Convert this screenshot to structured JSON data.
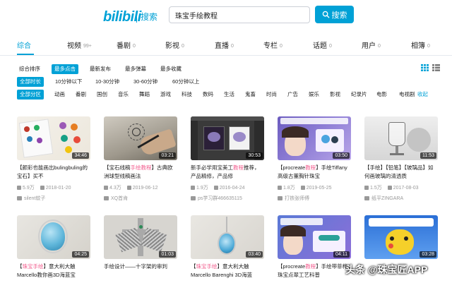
{
  "header": {
    "logo": "bilibili",
    "logo_sub": "搜索",
    "search_value": "珠宝手绘教程",
    "search_button": "搜索"
  },
  "type_tabs": [
    {
      "label": "综合",
      "count": ""
    },
    {
      "label": "视频",
      "count": "99+"
    },
    {
      "label": "番剧",
      "count": "0"
    },
    {
      "label": "影视",
      "count": "0"
    },
    {
      "label": "直播",
      "count": "0"
    },
    {
      "label": "专栏",
      "count": "0"
    },
    {
      "label": "话题",
      "count": "0"
    },
    {
      "label": "用户",
      "count": "0"
    },
    {
      "label": "相簿",
      "count": "0"
    }
  ],
  "sort_row": [
    "综合排序",
    "最多点击",
    "最新发布",
    "最多弹幕",
    "最多收藏"
  ],
  "duration_row": [
    "全部时长",
    "10分钟以下",
    "10-30分钟",
    "30-60分钟",
    "60分钟以上"
  ],
  "zone_row": [
    "全部分区",
    "动画",
    "番剧",
    "国创",
    "音乐",
    "舞蹈",
    "游戏",
    "科技",
    "数码",
    "生活",
    "鬼畜",
    "时尚",
    "广告",
    "娱乐",
    "影视",
    "纪录片",
    "电影",
    "电视剧"
  ],
  "zone_more": "收起",
  "cards": [
    {
      "duration": "34:46",
      "title_pre": "【颜彩也能画出bulingbuling的宝石】买不",
      "title_hl": "",
      "title_post": "",
      "views": "5.9万",
      "date": "2018-01-20",
      "uploader": "silent蚊子"
    },
    {
      "duration": "03:21",
      "title_pre": "【宝石线稿",
      "title_hl": "手绘教程",
      "title_post": "】古典欧洲球型线稿画法",
      "views": "4.3万",
      "date": "2019-06-12",
      "uploader": "XQ首肯"
    },
    {
      "duration": "30:53",
      "title_pre": "新手必学用宝美工",
      "title_hl": "教程",
      "title_post": "推荐，产品精修，产品修",
      "views": "1.9万",
      "date": "2016-04-24",
      "uploader": "ps学习群466635115"
    },
    {
      "duration": "03:50",
      "title_pre": "【procreate",
      "title_hl": "教程",
      "title_post": "】手绘Tiffany高级古董胸针珠宝",
      "views": "1.8万",
      "date": "2019-05-25",
      "uploader": "打铁张师傅"
    },
    {
      "duration": "11:53",
      "title_pre": "【手绘】【铅笔】【玻璃品】如何画玻璃的清透质",
      "title_hl": "",
      "title_post": "",
      "views": "1.5万",
      "date": "2017-08-03",
      "uploader": "纸平ZINGARA"
    },
    {
      "duration": "04:25",
      "title_pre": "【",
      "title_hl": "珠宝手绘",
      "title_post": "】意大利大触Marcello教你画3D海蓝宝",
      "views": "",
      "date": "",
      "uploader": ""
    },
    {
      "duration": "01:03",
      "title_pre": "手绘设计——十字架的审判",
      "title_hl": "",
      "title_post": "",
      "views": "",
      "date": "",
      "uploader": ""
    },
    {
      "duration": "03:40",
      "title_pre": "【",
      "title_hl": "珠宝手绘",
      "title_post": "】意大利大触Marcello Barenghi 3D海蓝",
      "views": "",
      "date": "",
      "uploader": ""
    },
    {
      "duration": "04:11",
      "title_pre": "【procreate",
      "title_hl": "教程",
      "title_post": "】手绘带菲桦珠宝点翠工艺科普",
      "views": "",
      "date": "",
      "uploader": ""
    },
    {
      "duration": "03:28",
      "title_pre": "",
      "title_hl": "",
      "title_post": "",
      "views": "",
      "date": "",
      "uploader": ""
    }
  ],
  "watermark": "头条 @珠宝匠APP",
  "colors": {
    "accent": "#00a1d6",
    "highlight": "#f25d8e"
  }
}
